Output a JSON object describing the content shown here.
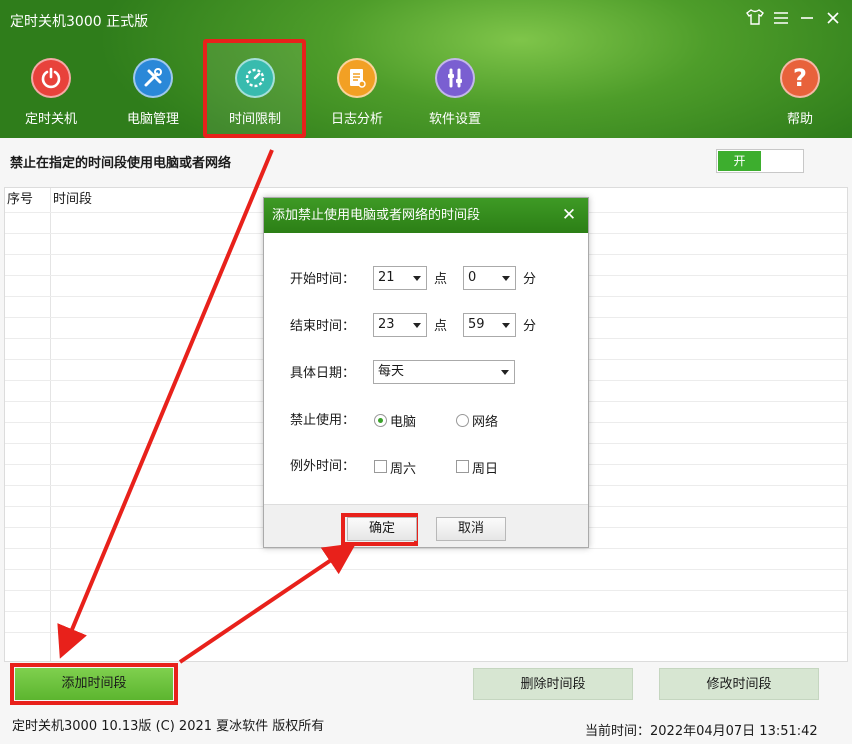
{
  "app": {
    "title": "定时关机3000 正式版"
  },
  "window_controls": {
    "skin_icon": "shirt-icon",
    "menu_icon": "menu-icon",
    "minimize_icon": "minimize-icon",
    "close_icon": "close-icon"
  },
  "nav": {
    "items": [
      {
        "label": "定时关机",
        "icon": "power-icon",
        "color": "#e8423b"
      },
      {
        "label": "电脑管理",
        "icon": "tools-icon",
        "color": "#2a88d8"
      },
      {
        "label": "时间限制",
        "icon": "timer-icon",
        "color": "#28b6a8",
        "active": true
      },
      {
        "label": "日志分析",
        "icon": "log-icon",
        "color": "#f2a024"
      },
      {
        "label": "软件设置",
        "icon": "settings-icon",
        "color": "#7a5fd1"
      }
    ],
    "help": {
      "label": "帮助",
      "icon": "help-icon",
      "color": "#e8623b"
    }
  },
  "main": {
    "section_title": "禁止在指定的时间段使用电脑或者网络",
    "toggle_label": "开",
    "table": {
      "columns": [
        "序号",
        "时间段"
      ],
      "rows": []
    },
    "buttons": {
      "add": "添加时间段",
      "delete": "删除时间段",
      "modify": "修改时间段"
    }
  },
  "footer": {
    "copyright": "定时关机3000 10.13版 (C) 2021 夏冰软件 版权所有",
    "current_time": "当前时间：2022年04月07日 13:51:42"
  },
  "dialog": {
    "title": "添加禁止使用电脑或者网络的时间段",
    "start_label": "开始时间：",
    "start_hour": "21",
    "start_minute": "0",
    "end_label": "结束时间：",
    "end_hour": "23",
    "end_minute": "59",
    "hour_unit": "点",
    "minute_unit": "分",
    "date_label": "具体日期：",
    "date_value": "每天",
    "forbid_label": "禁止使用：",
    "forbid_options": [
      "电脑",
      "网络"
    ],
    "forbid_selected": "电脑",
    "except_label": "例外时间：",
    "except_options": [
      "周六",
      "周日"
    ],
    "ok": "确定",
    "cancel": "取消"
  },
  "colors": {
    "accent_green": "#3dae2e",
    "highlight_red": "#e8211b"
  }
}
